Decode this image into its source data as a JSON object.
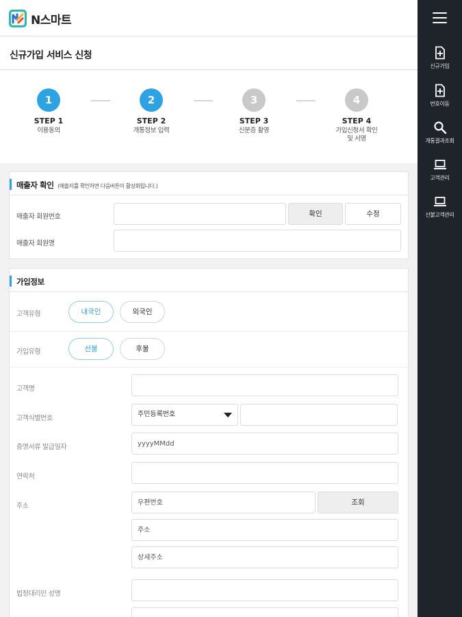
{
  "app": {
    "brand": "N스마트"
  },
  "page": {
    "title": "신규가입 서비스 신청"
  },
  "steps": [
    {
      "number": "1",
      "title": "STEP 1",
      "desc": "이용동의",
      "state": "active"
    },
    {
      "number": "2",
      "title": "STEP 2",
      "desc": "개통정보 입력",
      "state": "active"
    },
    {
      "number": "3",
      "title": "STEP 3",
      "desc": "신분증 촬영",
      "state": "inactive"
    },
    {
      "number": "4",
      "title": "STEP 4",
      "desc": "가입신청서 확인\n및 서명",
      "state": "inactive"
    }
  ],
  "seller": {
    "title": "매출자 확인",
    "note": "(매출자를 확인하면 다음버튼이 활성화됩니다.)",
    "member_no_label": "매출자 회원번호",
    "member_no_value": "",
    "confirm_label": "확인",
    "edit_label": "수정",
    "member_name_label": "매출자 회원명",
    "member_name_value": ""
  },
  "signup": {
    "title": "가입정보",
    "customer_type_label": "고객유형",
    "customer_type_options": [
      "내국인",
      "외국인"
    ],
    "customer_type_selected": "내국인",
    "join_type_label": "가입유형",
    "join_type_options": [
      "선불",
      "후불"
    ],
    "join_type_selected": "선불",
    "customer_name_label": "고객명",
    "customer_id_label": "고객식별번호",
    "customer_id_type": "주민등록번호",
    "doc_date_label": "증명서류 발급일자",
    "doc_date_placeholder": "yyyyMMdd",
    "contact_label": "연락처",
    "address_label": "주소",
    "zipcode_placeholder": "우편번호",
    "lookup_label": "조회",
    "address_placeholder": "주소",
    "address_detail_placeholder": "상세주소",
    "guardian_name_label": "법정대리인 성명"
  },
  "sidebar": {
    "items": [
      {
        "label": "신규가입",
        "icon": "file-plus-icon"
      },
      {
        "label": "번호이동",
        "icon": "file-plus-icon"
      },
      {
        "label": "개통결과조회",
        "icon": "search-icon"
      },
      {
        "label": "고객관리",
        "icon": "laptop-icon"
      },
      {
        "label": "선불고객관리",
        "icon": "laptop-icon"
      }
    ]
  },
  "colors": {
    "accent": "#2ea3e3",
    "rail": "#1f242b",
    "inactive_step": "#c9c9c9"
  }
}
